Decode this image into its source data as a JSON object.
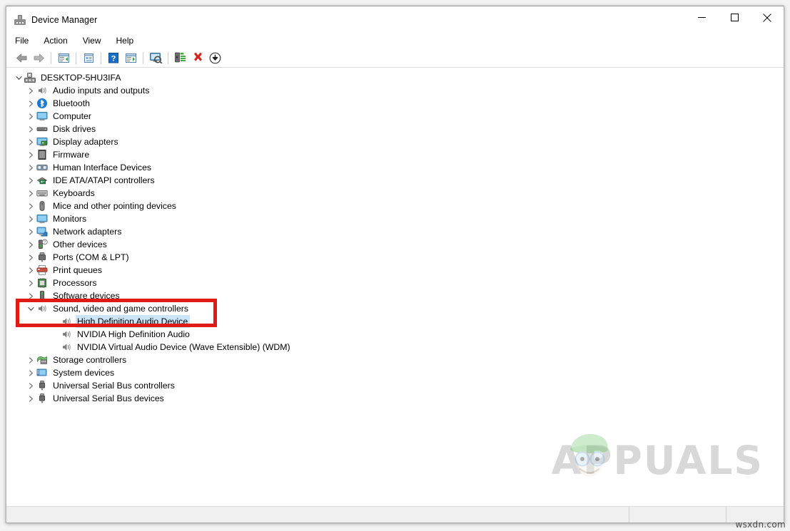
{
  "window": {
    "title": "Device Manager",
    "app_icon": "device-manager-icon",
    "minimize_label": "Minimize",
    "maximize_label": "Maximize",
    "close_label": "Close"
  },
  "menubar": {
    "items": [
      {
        "label": "File"
      },
      {
        "label": "Action"
      },
      {
        "label": "View"
      },
      {
        "label": "Help"
      }
    ]
  },
  "toolbar": {
    "buttons": [
      {
        "icon": "back-arrow-icon",
        "label": "Back"
      },
      {
        "icon": "forward-arrow-icon",
        "label": "Forward"
      },
      {
        "icon": "show-hide-console-tree-icon",
        "label": "Show/Hide Console Tree"
      },
      {
        "icon": "properties-icon",
        "label": "Properties"
      },
      {
        "icon": "help-icon",
        "label": "Help"
      },
      {
        "icon": "action-pane-icon",
        "label": "Show/Hide Action Pane"
      },
      {
        "icon": "scan-hardware-changes-icon",
        "label": "Scan for hardware changes"
      },
      {
        "icon": "update-driver-icon",
        "label": "Update driver"
      },
      {
        "icon": "uninstall-device-icon",
        "label": "Uninstall device"
      },
      {
        "icon": "disable-device-icon",
        "label": "Disable device"
      }
    ]
  },
  "tree": {
    "root": {
      "label": "DESKTOP-5HU3IFA",
      "icon": "computer-root-icon",
      "expanded": true
    },
    "items": [
      {
        "label": "Audio inputs and outputs",
        "icon": "speaker-icon",
        "level": 1,
        "expandable": true,
        "expanded": false,
        "selected": false
      },
      {
        "label": "Bluetooth",
        "icon": "bluetooth-icon",
        "level": 1,
        "expandable": true,
        "expanded": false,
        "selected": false
      },
      {
        "label": "Computer",
        "icon": "monitor-icon",
        "level": 1,
        "expandable": true,
        "expanded": false,
        "selected": false
      },
      {
        "label": "Disk drives",
        "icon": "disk-drive-icon",
        "level": 1,
        "expandable": true,
        "expanded": false,
        "selected": false
      },
      {
        "label": "Display adapters",
        "icon": "display-adapter-icon",
        "level": 1,
        "expandable": true,
        "expanded": false,
        "selected": false
      },
      {
        "label": "Firmware",
        "icon": "firmware-chip-icon",
        "level": 1,
        "expandable": true,
        "expanded": false,
        "selected": false
      },
      {
        "label": "Human Interface Devices",
        "icon": "hid-icon",
        "level": 1,
        "expandable": true,
        "expanded": false,
        "selected": false
      },
      {
        "label": "IDE ATA/ATAPI controllers",
        "icon": "ide-controller-icon",
        "level": 1,
        "expandable": true,
        "expanded": false,
        "selected": false
      },
      {
        "label": "Keyboards",
        "icon": "keyboard-icon",
        "level": 1,
        "expandable": true,
        "expanded": false,
        "selected": false
      },
      {
        "label": "Mice and other pointing devices",
        "icon": "mouse-icon",
        "level": 1,
        "expandable": true,
        "expanded": false,
        "selected": false
      },
      {
        "label": "Monitors",
        "icon": "monitor-icon",
        "level": 1,
        "expandable": true,
        "expanded": false,
        "selected": false
      },
      {
        "label": "Network adapters",
        "icon": "network-adapter-icon",
        "level": 1,
        "expandable": true,
        "expanded": false,
        "selected": false
      },
      {
        "label": "Other devices",
        "icon": "other-device-icon",
        "level": 1,
        "expandable": true,
        "expanded": false,
        "selected": false
      },
      {
        "label": "Ports (COM & LPT)",
        "icon": "port-icon",
        "level": 1,
        "expandable": true,
        "expanded": false,
        "selected": false
      },
      {
        "label": "Print queues",
        "icon": "printer-icon",
        "level": 1,
        "expandable": true,
        "expanded": false,
        "selected": false
      },
      {
        "label": "Processors",
        "icon": "processor-icon",
        "level": 1,
        "expandable": true,
        "expanded": false,
        "selected": false
      },
      {
        "label": "Software devices",
        "icon": "software-device-icon",
        "level": 1,
        "expandable": true,
        "expanded": false,
        "selected": false
      },
      {
        "label": "Sound, video and game controllers",
        "icon": "speaker-icon",
        "level": 1,
        "expandable": true,
        "expanded": true,
        "selected": false
      },
      {
        "label": "High Definition Audio Device",
        "icon": "speaker-icon",
        "level": 2,
        "expandable": false,
        "expanded": false,
        "selected": true
      },
      {
        "label": "NVIDIA High Definition Audio",
        "icon": "speaker-icon",
        "level": 2,
        "expandable": false,
        "expanded": false,
        "selected": false
      },
      {
        "label": "NVIDIA Virtual Audio Device (Wave Extensible) (WDM)",
        "icon": "speaker-icon",
        "level": 2,
        "expandable": false,
        "expanded": false,
        "selected": false
      },
      {
        "label": "Storage controllers",
        "icon": "storage-controller-icon",
        "level": 1,
        "expandable": true,
        "expanded": false,
        "selected": false
      },
      {
        "label": "System devices",
        "icon": "system-device-icon",
        "level": 1,
        "expandable": true,
        "expanded": false,
        "selected": false
      },
      {
        "label": "Universal Serial Bus controllers",
        "icon": "usb-icon",
        "level": 1,
        "expandable": true,
        "expanded": false,
        "selected": false
      },
      {
        "label": "Universal Serial Bus devices",
        "icon": "usb-icon",
        "level": 1,
        "expandable": true,
        "expanded": false,
        "selected": false
      }
    ]
  },
  "annotation": {
    "highlight_color": "#e01b16",
    "highlights": [
      "Sound, video and game controllers",
      "High Definition Audio Device"
    ]
  },
  "statusbar": {
    "pane1": "",
    "pane2": "",
    "pane3": ""
  },
  "watermark": {
    "brand": "APPUALS",
    "brand_color": "#d8d8d8",
    "site_tag": "wsxdn.com"
  },
  "colors": {
    "selection": "#cce4f7",
    "chevron": "#767676",
    "window_border": "#b4b4b4"
  }
}
